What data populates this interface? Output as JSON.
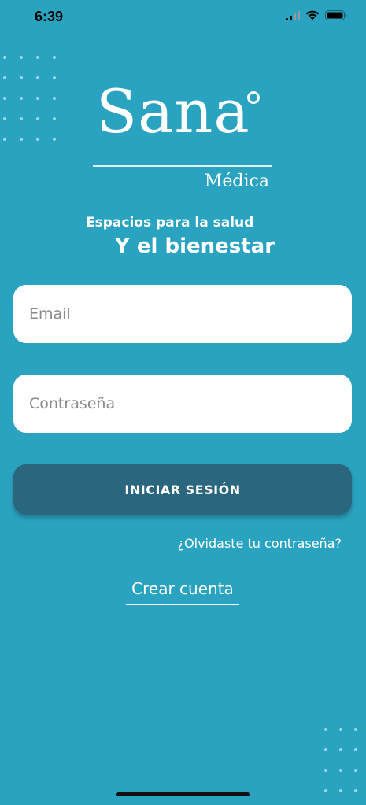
{
  "status_bar": {
    "time": "6:39",
    "icons": [
      "signal-icon",
      "wifi-icon",
      "battery-icon"
    ]
  },
  "logo": {
    "word": "Sana",
    "subtitle": "Médica"
  },
  "tagline": {
    "line1": "Espacios para la salud",
    "line2": "Y el bienestar"
  },
  "form": {
    "email_placeholder": "Email",
    "password_placeholder": "Contraseña",
    "login_label": "INICIAR SESIÓN",
    "forgot_label": "¿Olvidaste tu contraseña?",
    "create_label": "Crear cuenta"
  },
  "colors": {
    "background": "#2aa3c0",
    "button": "#2a667e",
    "text": "#ffffff"
  }
}
